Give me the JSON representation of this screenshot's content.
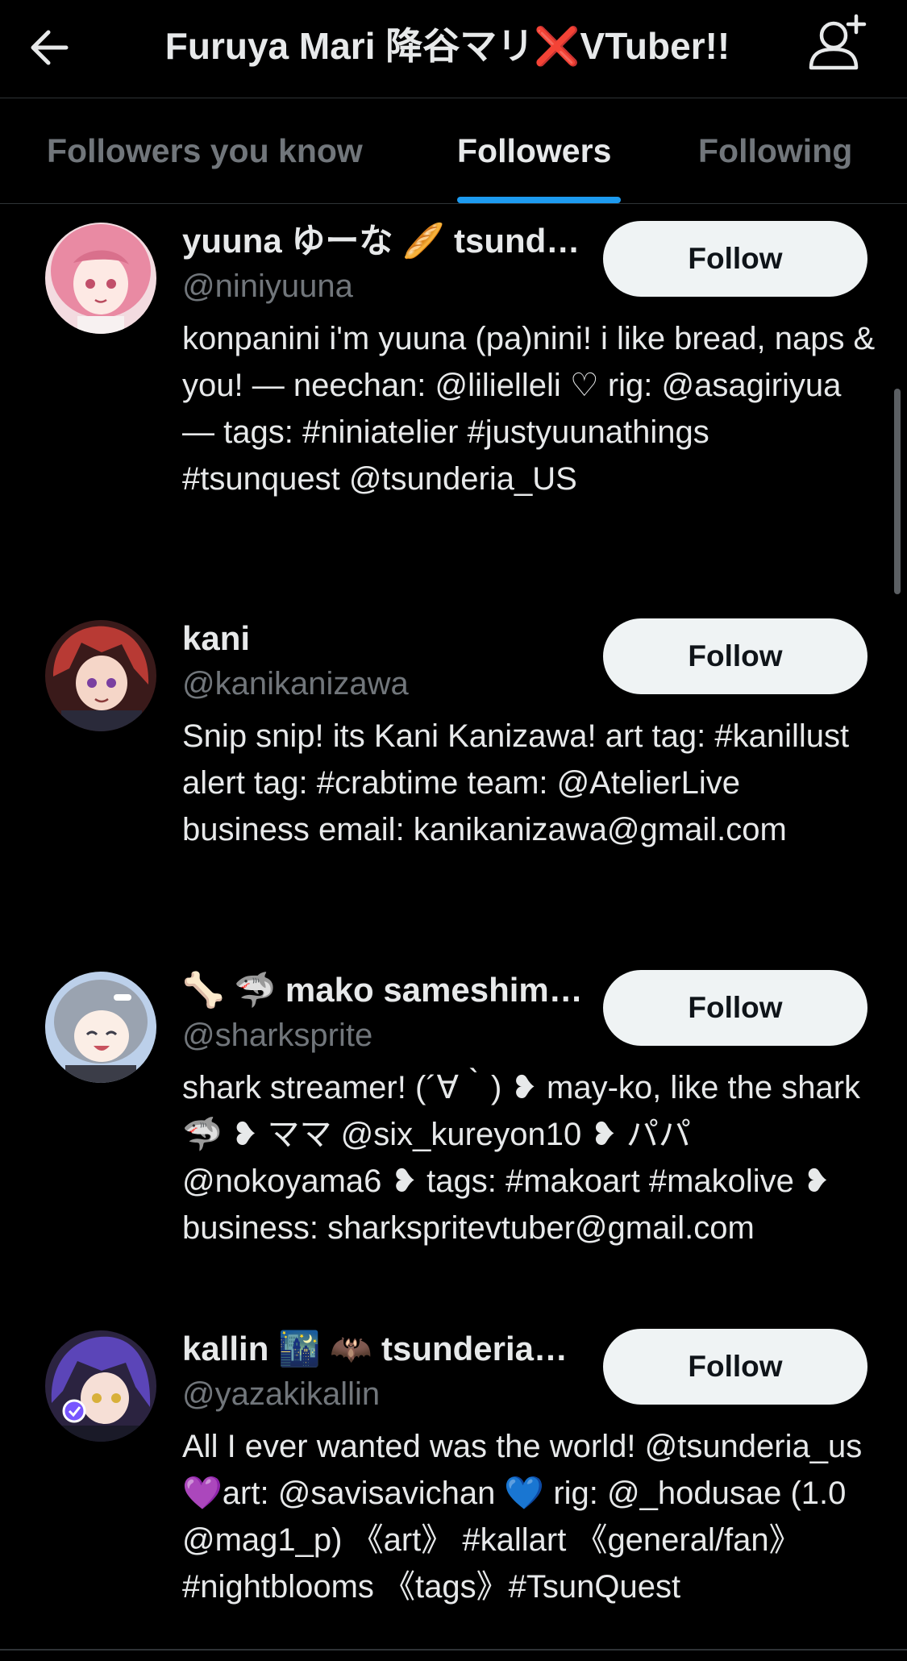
{
  "header": {
    "title": "Furuya Mari 降谷マリ❌VTuber!!",
    "back_icon": "arrow-left-icon",
    "add_icon": "person-add-icon"
  },
  "tabs": [
    {
      "label": "Followers you know",
      "active": false
    },
    {
      "label": "Followers",
      "active": true
    },
    {
      "label": "Following",
      "active": false
    }
  ],
  "colors": {
    "accent": "#1d9bf0",
    "background": "#000000",
    "text": "#e7e9ea",
    "muted": "#71767b",
    "button_bg": "#eff3f4"
  },
  "users": [
    {
      "name": "yuuna ゆーな 🥖 tsund…",
      "handle": "@niniyuuna",
      "bio": "konpanini i'm yuuna (pa)nini! i like bread, naps & you! — neechan: @lilielleli ♡ rig: @asagiriyua — tags: #niniatelier #justyuunathings #tsunquest @tsunderia_US",
      "button": "Follow"
    },
    {
      "name": "kani",
      "handle": "@kanikanizawa",
      "bio": "Snip snip! its Kani Kanizawa! art tag: #kanillust alert tag: #crabtime team: @AtelierLive business email: kanikanizawa@gmail.com",
      "button": "Follow"
    },
    {
      "name": "🦴 🦈 mako sameshim…",
      "handle": "@sharksprite",
      "bio": "shark streamer! (´∀｀) ❥ may-ko, like the shark 🦈 ❥ ママ @six_kureyon10 ❥ パパ @nokoyama6 ❥ tags: #makoart #makolive ❥ business: sharkspritevtuber@gmail.com",
      "button": "Follow"
    },
    {
      "name": "kallin 🌃 🦇 tsunderia…",
      "handle": "@yazakikallin",
      "bio": "All I ever wanted was the world! @tsunderia_us 💜art: @savisavichan 💙 rig: @_hodusae (1.0 @mag1_p) 《art》 #kallart 《general/fan》#nightblooms 《tags》#TsunQuest",
      "button": "Follow"
    }
  ]
}
